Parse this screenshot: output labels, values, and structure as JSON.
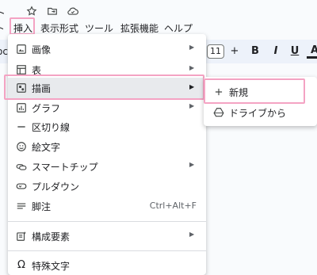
{
  "title_bar": {
    "title_fragment": "ト",
    "icons": [
      "star-icon",
      "move-to-folder-icon",
      "cloud-status-icon"
    ]
  },
  "menubar": {
    "items": [
      {
        "label": "ト"
      },
      {
        "label": "挿入"
      },
      {
        "label": "表示形式"
      },
      {
        "label": "ツール"
      },
      {
        "label": "拡張機能"
      },
      {
        "label": "ヘルプ"
      }
    ]
  },
  "toolbar": {
    "left_fragment": "oc",
    "font_size": "11",
    "plus_label": "+",
    "bold_label": "B",
    "italic_label": "I",
    "underline_label": "U",
    "color_label": "A"
  },
  "insert_menu": {
    "items": [
      {
        "label": "画像",
        "icon": "image-icon",
        "has_submenu": true
      },
      {
        "label": "表",
        "icon": "table-icon",
        "has_submenu": true
      },
      {
        "label": "描画",
        "icon": "drawing-icon",
        "has_submenu": true,
        "active": true
      },
      {
        "label": "グラフ",
        "icon": "chart-icon",
        "has_submenu": true
      },
      {
        "label": "区切り線",
        "icon": "horizontal-line-icon",
        "has_submenu": false
      },
      {
        "label": "絵文字",
        "icon": "emoji-icon",
        "has_submenu": false
      },
      {
        "label": "スマートチップ",
        "icon": "smart-chip-icon",
        "has_submenu": true
      },
      {
        "label": "プルダウン",
        "icon": "dropdown-icon",
        "has_submenu": false
      },
      {
        "label": "脚注",
        "icon": "footnote-icon",
        "has_submenu": false,
        "shortcut": "Ctrl+Alt+F"
      },
      {
        "label": "構成要素",
        "icon": "building-blocks-icon",
        "has_submenu": true
      },
      {
        "label": "特殊文字",
        "icon": "omega-icon",
        "has_submenu": false
      }
    ]
  },
  "drawing_submenu": {
    "items": [
      {
        "label": "新規",
        "icon": "plus-icon"
      },
      {
        "label": "ドライブから",
        "icon": "drive-icon"
      }
    ]
  },
  "colors": {
    "highlight_border": "#f4a3c3",
    "menu_background": "#ffffff",
    "active_item": "#e8eaed",
    "toolbar_background": "#edf2fa"
  }
}
